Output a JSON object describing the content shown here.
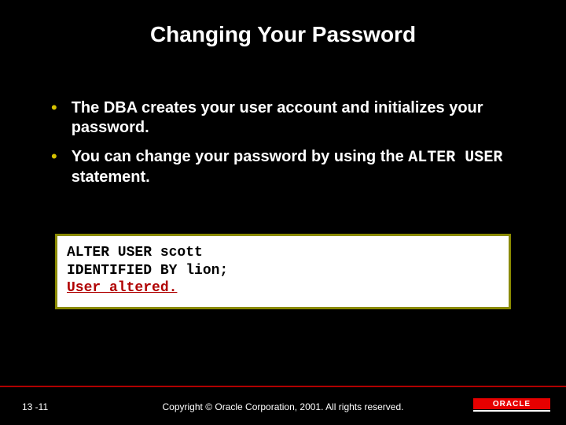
{
  "title": "Changing Your Password",
  "bullets": [
    {
      "text_full": "The DBA creates your user account and initializes your password."
    },
    {
      "text_pre": "You can change your password by using the ",
      "text_code": "ALTER USER",
      "text_post": " statement."
    }
  ],
  "code": {
    "line1": "ALTER USER scott",
    "line2": "IDENTIFIED BY lion;",
    "result": "User altered."
  },
  "footer": {
    "page": "13 -11",
    "copyright": "Copyright © Oracle Corporation, 2001. All rights reserved.",
    "logo": "ORACLE"
  }
}
